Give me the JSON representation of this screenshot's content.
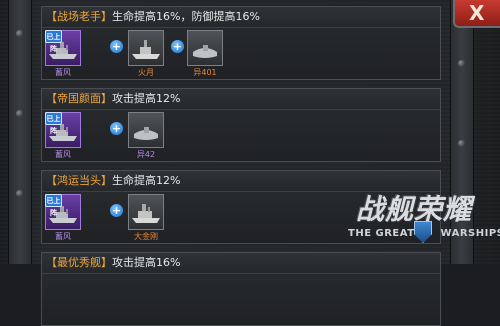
{
  "close_label": "X",
  "combos": [
    {
      "title": "【战场老手】",
      "effect": "生命提高16%，防御提高16%",
      "ships": [
        {
          "name": "蓄风",
          "quality": "purple",
          "badge": "已上阵"
        },
        {
          "name": "火月",
          "quality": "grey"
        },
        {
          "name": "异401",
          "quality": "grey"
        }
      ]
    },
    {
      "title": "【帝国颜面】",
      "effect": "攻击提高12%",
      "ships": [
        {
          "name": "蓄风",
          "quality": "purple",
          "badge": "已上阵"
        },
        {
          "name": "异42",
          "quality": "grey"
        }
      ]
    },
    {
      "title": "【鸿运当头】",
      "effect": "生命提高12%",
      "ships": [
        {
          "name": "蓄风",
          "quality": "purple",
          "badge": "已上阵"
        },
        {
          "name": "大金刚",
          "quality": "grey"
        }
      ]
    },
    {
      "title": "【最优秀舰】",
      "effect": "攻击提高16%",
      "ships": []
    }
  ],
  "logo": {
    "chinese": "战舰荣耀",
    "english_left": "THE GREAT",
    "english_right": "WARSHIPS"
  }
}
